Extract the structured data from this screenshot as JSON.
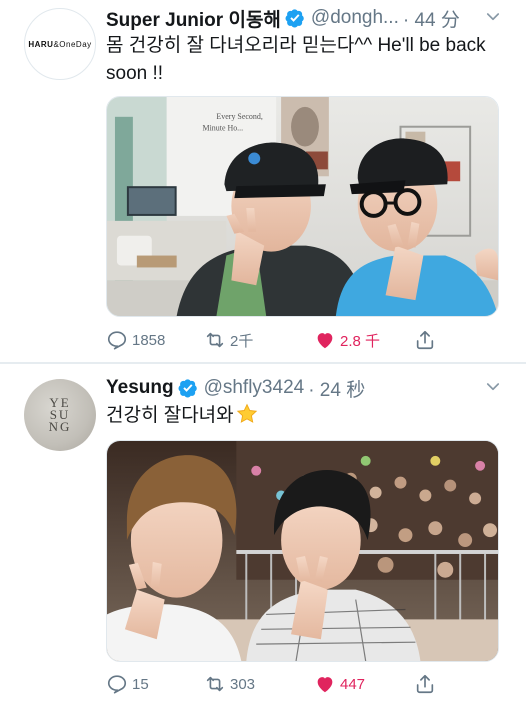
{
  "tweets": [
    {
      "name": "Super Junior 이동해",
      "handle": "@dongh...",
      "time": "· 44 分",
      "text": "몸 건강히 잘 다녀오리라 믿는다^^ He'll be back soon !!",
      "avatar_text": [
        "HARU",
        "&",
        "OneDay"
      ],
      "image_signage": [
        "Every Second,",
        "Minute Ho..."
      ],
      "counts": {
        "replies": "1858",
        "retweets": "2千",
        "likes": "2.8 千"
      }
    },
    {
      "name": "Yesung",
      "handle": "@shfly3424",
      "time": "· 24 秒",
      "text": "건강히 잘다녀와",
      "avatar_text": [
        "YE",
        "SU",
        "NG"
      ],
      "counts": {
        "replies": "15",
        "retweets": "303",
        "likes": "447"
      }
    }
  ],
  "icons": [
    "verified-badge-icon",
    "chevron-down-icon",
    "reply-icon",
    "retweet-icon",
    "heart-icon",
    "share-icon",
    "star-emoji"
  ],
  "colors": {
    "verified": "#1da1f2",
    "like": "#e0245e",
    "muted": "#657786",
    "separator": "#e6ecf0"
  }
}
